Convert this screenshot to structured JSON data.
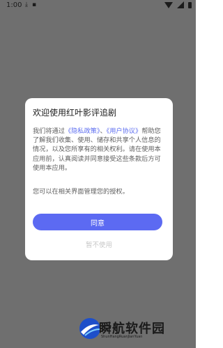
{
  "status_bar": {
    "time": "1:00",
    "icons_left": [
      "download-icon",
      "notification-icon"
    ],
    "icons_right": [
      "wifi-icon",
      "signal-icon",
      "battery-icon"
    ]
  },
  "dialog": {
    "title": "欢迎使用红叶影评追剧",
    "body_prefix": "我们将通过",
    "privacy_link": "《隐私政策》",
    "separator": "、",
    "agreement_link": "《用户协议》",
    "body_rest": "帮助您了解我们收集、使用、储存和共享个人信息的情况，以及您所享有的相关权利。请在使用本应用前，认真阅读并同意接受这些条款后方可使用本应用。",
    "note": "您可以在相关界面管理您的授权。",
    "agree_label": "同意",
    "decline_label": "暂不使用"
  },
  "watermark": {
    "title": "瞬航软件园",
    "subtitle": "ShunHangRuanJianYuan"
  },
  "colors": {
    "overlay": "#6f6f6f",
    "accent": "#5c6af2",
    "link": "#5b6cf0"
  }
}
